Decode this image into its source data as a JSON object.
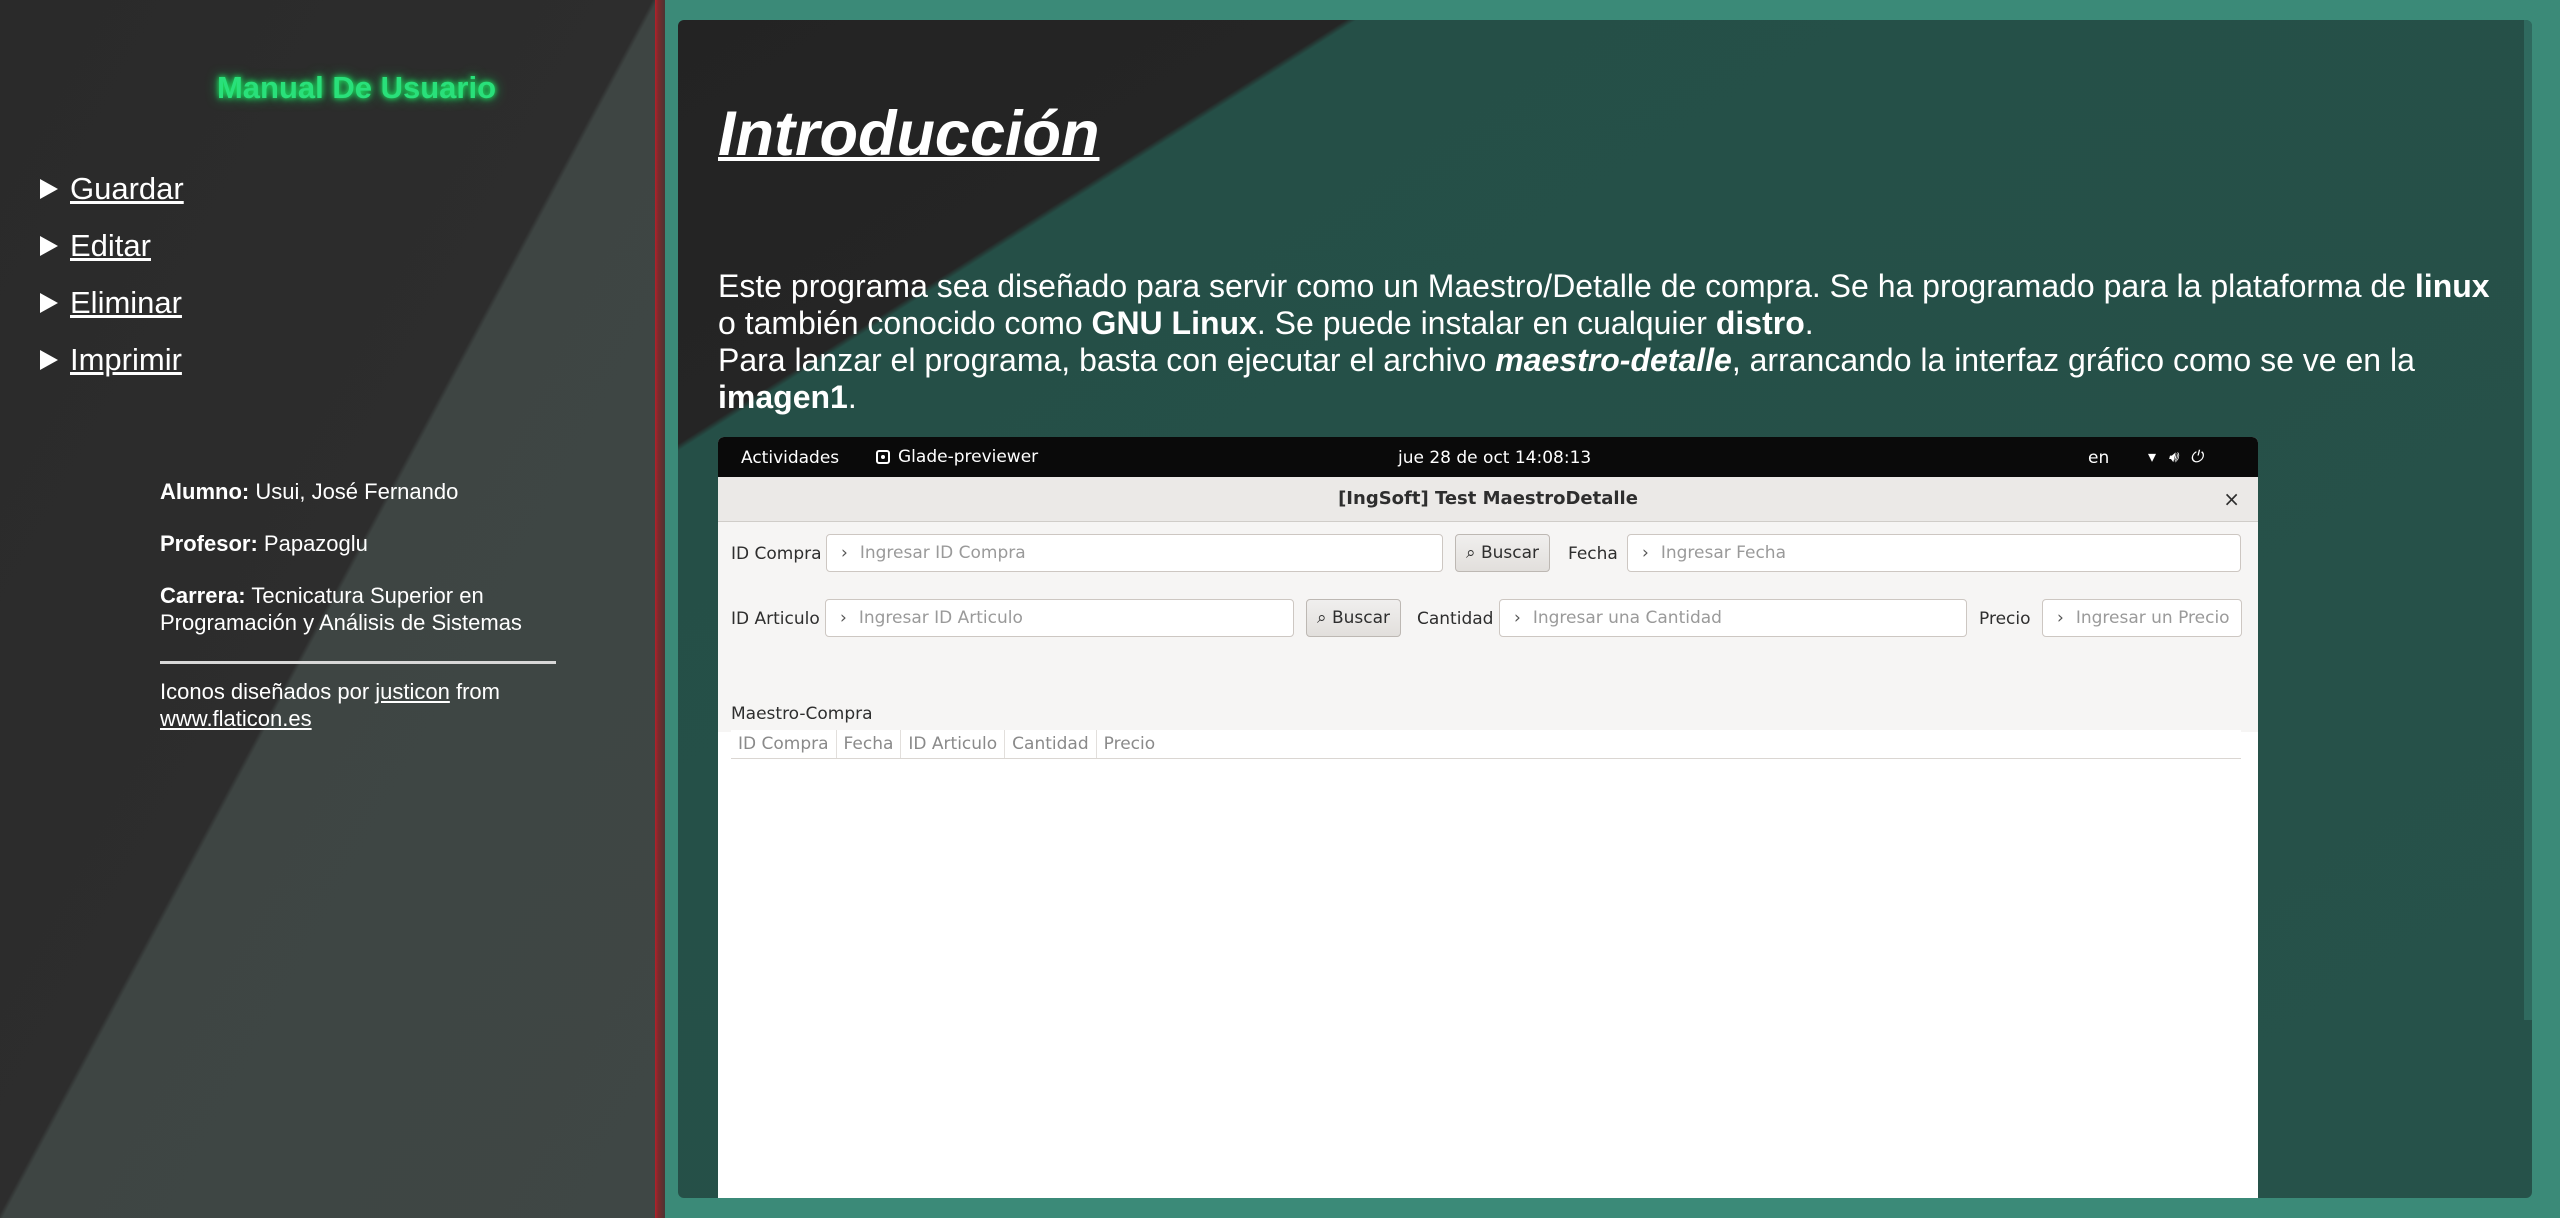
{
  "sidebar": {
    "title": "Manual De Usuario",
    "nav": [
      "Guardar",
      "Editar",
      "Eliminar",
      "Imprimir"
    ],
    "alumno_label": "Alumno:",
    "alumno_value": "Usui, José Fernando",
    "profesor_label": "Profesor:",
    "profesor_value": "Papazoglu",
    "carrera_label": "Carrera:",
    "carrera_value": "Tecnicatura Superior en Programación y Análisis de Sistemas",
    "credits_prefix": "Iconos diseñados por",
    "credits_author": "justicon",
    "credits_from": "from",
    "credits_site": "www.flaticon.es"
  },
  "main": {
    "title": "Introducción",
    "p1_a": "Este programa sea diseñado para servir como un Maestro/Detalle de compra. Se ha programado para la plataforma de",
    "p1_b": "linux",
    "p1_c": "o también conocido como",
    "p1_d": "GNU Linux",
    "p1_e": ". Se puede instalar en cualquier",
    "p1_f": "distro",
    "p2_a": "Para lanzar el programa, basta con ejecutar el archivo",
    "p2_b": "maestro-detalle",
    "p2_c": ", arrancando la interfaz gráfico como se ve en la",
    "p2_d": "imagen1"
  },
  "screenshot": {
    "activities": "Actividades",
    "app_name": "Glade-previewer",
    "clock": "jue 28 de oct  14:08:13",
    "lang": "en",
    "window_title": "[IngSoft] Test MaestroDetalle",
    "close": "×",
    "id_compra_label": "ID Compra",
    "id_compra_placeholder": "Ingresar ID Compra",
    "buscar": "Buscar",
    "fecha_label": "Fecha",
    "fecha_placeholder": "Ingresar Fecha",
    "id_articulo_label": "ID Articulo",
    "id_articulo_placeholder": "Ingresar ID Articulo",
    "cantidad_label": "Cantidad",
    "cantidad_placeholder": "Ingresar una Cantidad",
    "precio_label": "Precio",
    "precio_placeholder": "Ingresar un Precio",
    "section": "Maestro-Compra",
    "columns": [
      "ID Compra",
      "Fecha",
      "ID Articulo",
      "Cantidad",
      "Precio"
    ]
  },
  "colors": {
    "title_glow": "#29e07a",
    "panel": "#26524a",
    "background": "#3b8a78"
  }
}
